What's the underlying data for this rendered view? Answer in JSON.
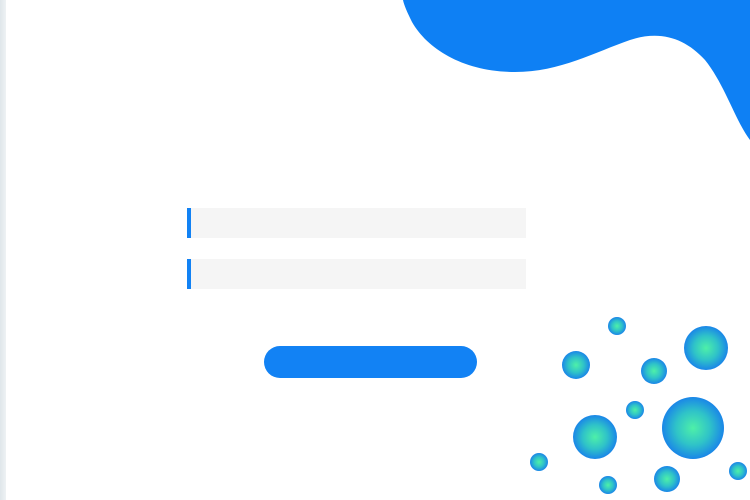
{
  "login_form": {
    "field_1": {
      "value": "",
      "placeholder": ""
    },
    "field_2": {
      "value": "",
      "placeholder": ""
    },
    "submit_label": ""
  },
  "colors": {
    "accent": "#1282f4",
    "field_background": "#f5f5f5",
    "bubble_center": "#4ef0a8",
    "bubble_edge": "#1a86e8"
  }
}
